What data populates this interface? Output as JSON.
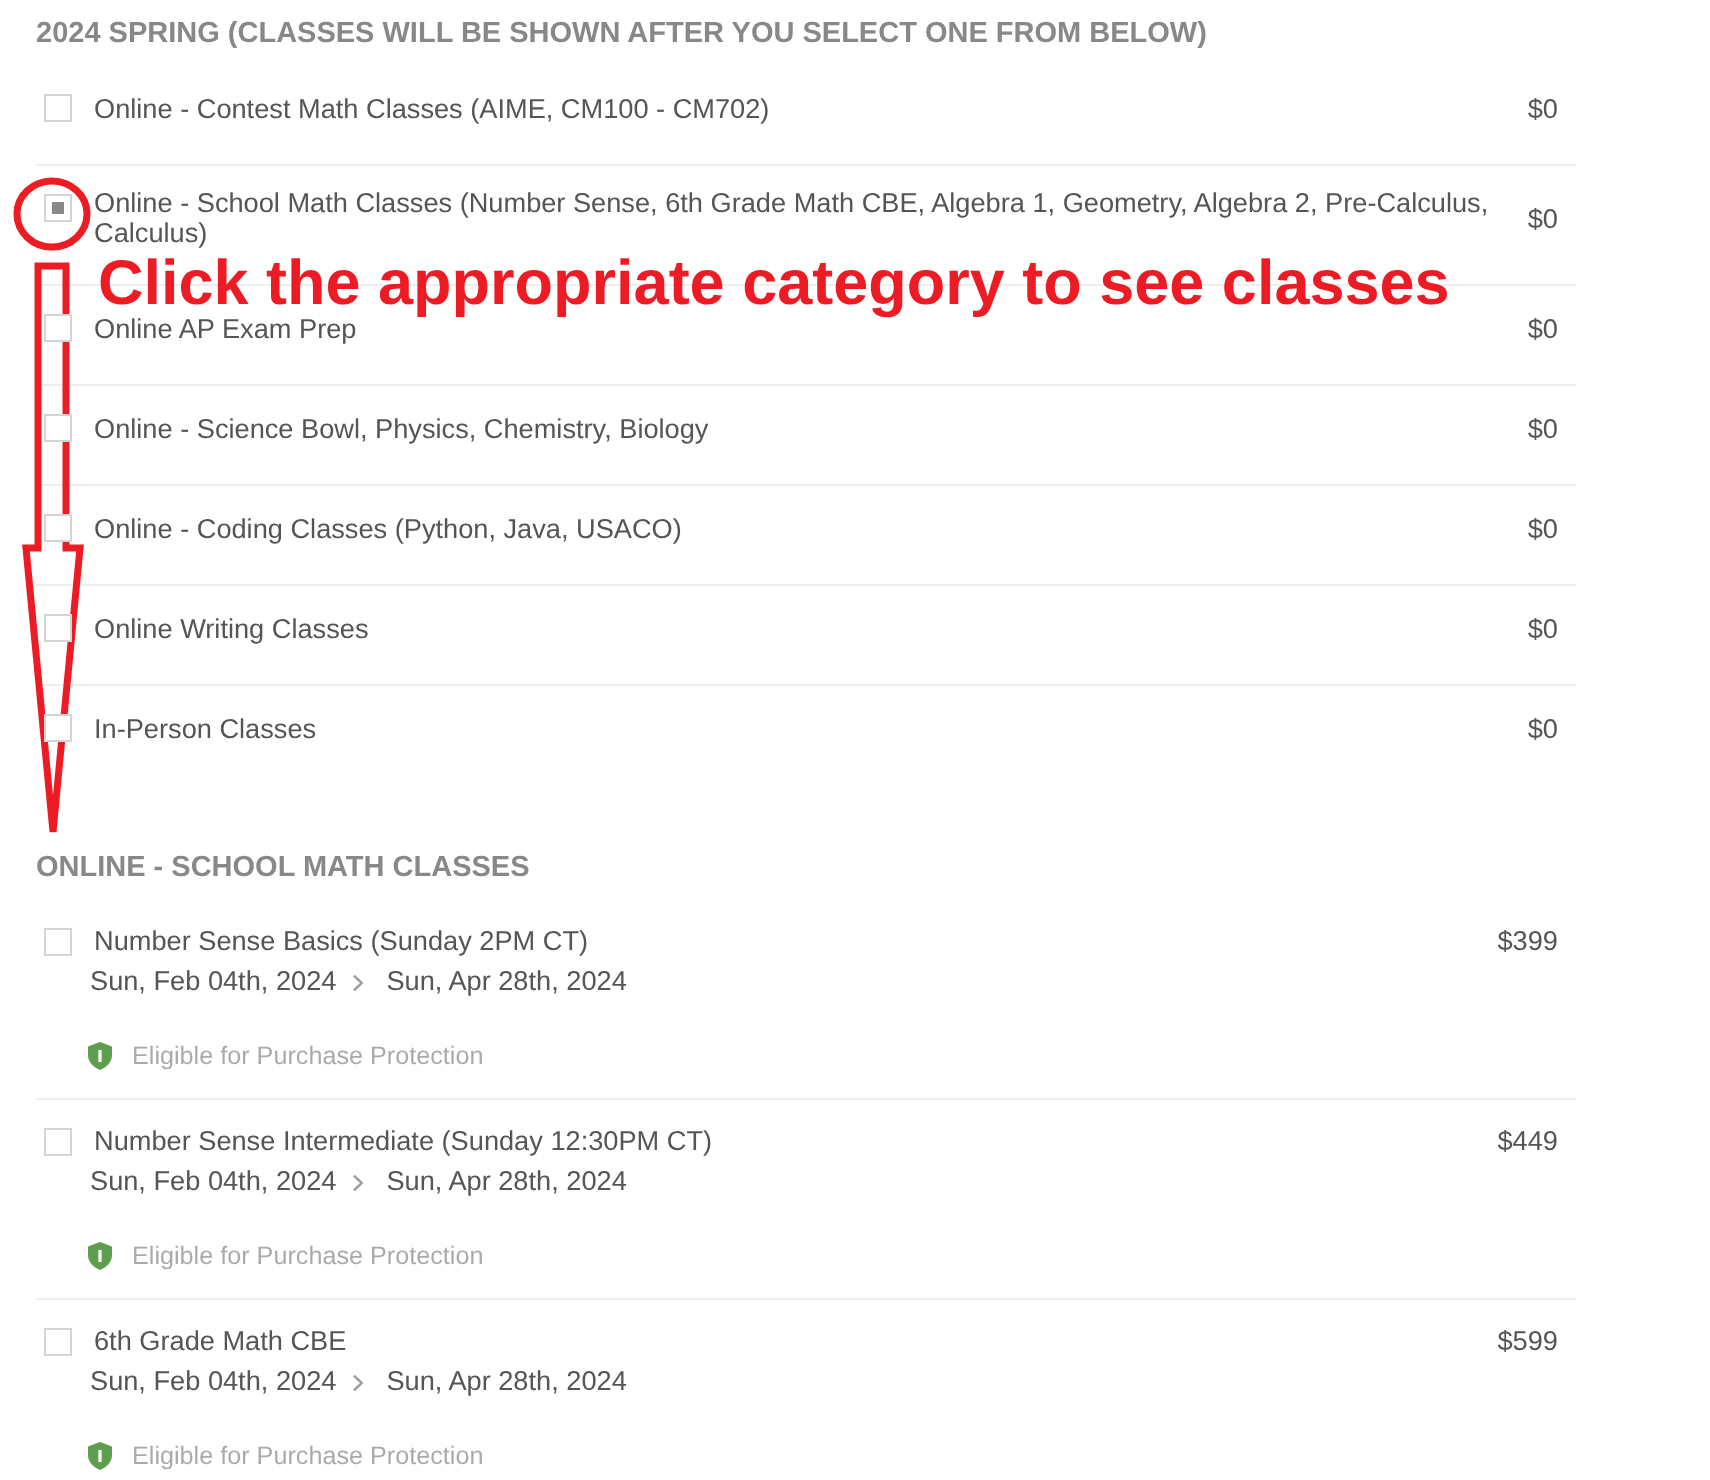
{
  "category_section": {
    "heading": "2024 SPRING (CLASSES WILL BE SHOWN AFTER YOU SELECT ONE FROM BELOW)",
    "items": [
      {
        "label": "Online - Contest Math Classes (AIME, CM100 - CM702)",
        "price": "$0",
        "checked": false
      },
      {
        "label": "Online - School Math Classes (Number Sense, 6th Grade Math CBE, Algebra 1, Geometry, Algebra 2, Pre-Calculus, Calculus)",
        "price": "$0",
        "checked": true
      },
      {
        "label": "Online AP Exam Prep",
        "price": "$0",
        "checked": false
      },
      {
        "label": "Online - Science Bowl, Physics, Chemistry, Biology",
        "price": "$0",
        "checked": false
      },
      {
        "label": "Online - Coding Classes (Python, Java, USACO)",
        "price": "$0",
        "checked": false
      },
      {
        "label": "Online Writing Classes",
        "price": "$0",
        "checked": false
      },
      {
        "label": "In-Person Classes",
        "price": "$0",
        "checked": false
      }
    ]
  },
  "annotation": {
    "text": "Click the appropriate category to see classes"
  },
  "class_section": {
    "heading": "ONLINE - SCHOOL MATH CLASSES",
    "classes": [
      {
        "title": "Number Sense Basics (Sunday 2PM CT)",
        "start_date": "Sun, Feb 04th, 2024",
        "end_date": "Sun, Apr 28th, 2024",
        "protection": "Eligible for Purchase Protection",
        "price": "$399",
        "checked": false
      },
      {
        "title": "Number Sense Intermediate (Sunday 12:30PM CT)",
        "start_date": "Sun, Feb 04th, 2024",
        "end_date": "Sun, Apr 28th, 2024",
        "protection": "Eligible for Purchase Protection",
        "price": "$449",
        "checked": false
      },
      {
        "title": "6th Grade Math CBE",
        "start_date": "Sun, Feb 04th, 2024",
        "end_date": "Sun, Apr 28th, 2024",
        "protection": "Eligible for Purchase Protection",
        "price": "$599",
        "checked": false
      }
    ]
  }
}
